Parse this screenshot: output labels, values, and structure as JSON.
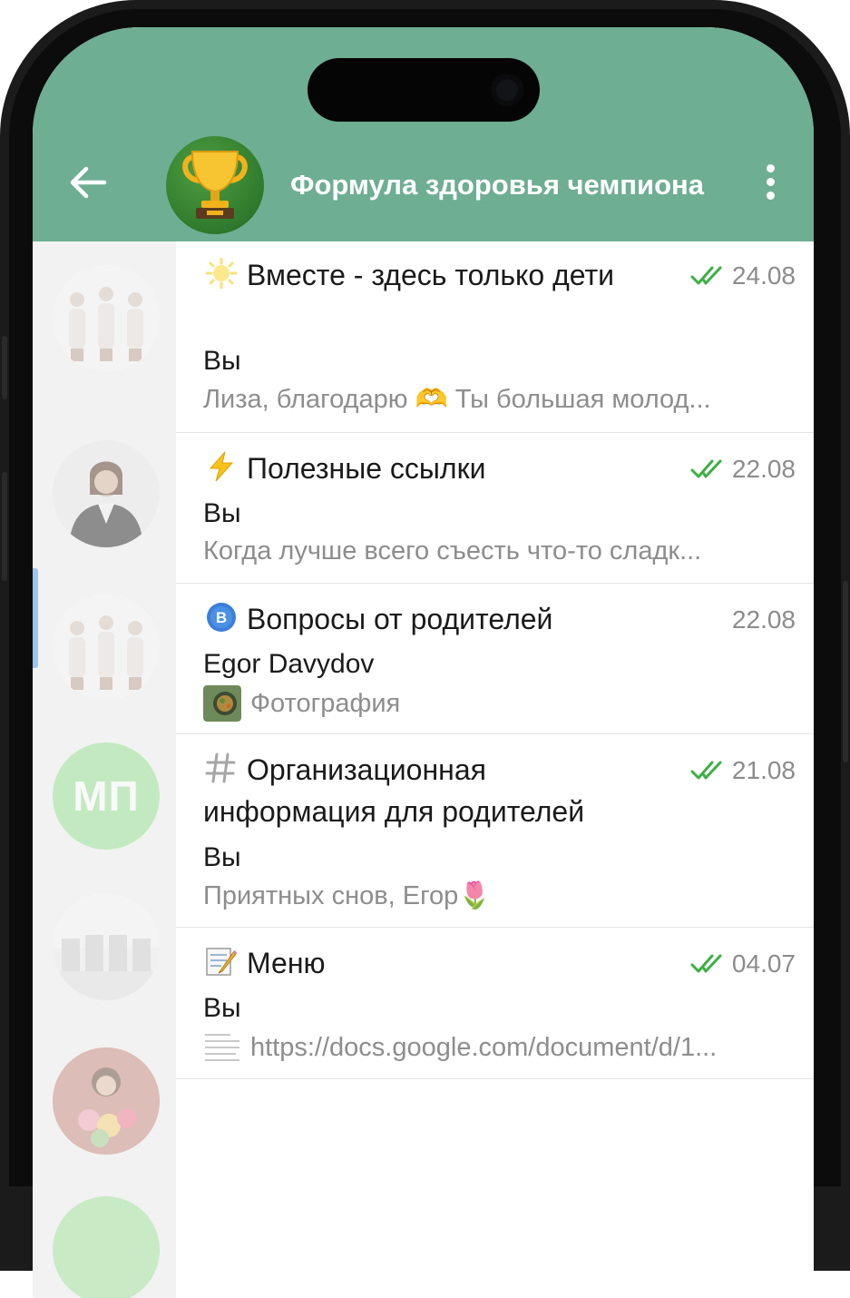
{
  "header": {
    "title": "Формула здоровья чемпиона",
    "back_icon": "arrow-left-icon",
    "avatar_icon": "trophy-icon",
    "menu_icon": "more-vertical-icon",
    "color": "#6eae93"
  },
  "topics": [
    {
      "icon": "sun-icon",
      "title": "Вместе - здесь только дети",
      "date": "24.08",
      "read": true,
      "sender": "Вы",
      "preview": "Лиза, благодарю 🫶 Ты большая молод..."
    },
    {
      "icon": "lightning-icon",
      "title": "Полезные ссылки",
      "date": "22.08",
      "read": true,
      "sender": "Вы",
      "preview": "Когда лучше всего съесть что-то сладк..."
    },
    {
      "icon": "letter-b-icon",
      "title": "Вопросы от родителей",
      "date": "22.08",
      "read": false,
      "sender": "Egor Davydov",
      "preview": "Фотография"
    },
    {
      "icon": "hash-icon",
      "title": "Организационная информация для родителей",
      "date": "21.08",
      "read": true,
      "sender": "Вы",
      "preview": "Приятных снов, Егор🌷"
    },
    {
      "icon": "memo-icon",
      "title": "Меню",
      "date": "04.07",
      "read": true,
      "sender": "Вы",
      "preview": "https://docs.google.com/document/d/1..."
    }
  ],
  "sidebar": {
    "mp_initials": "МП"
  },
  "colors": {
    "check": "#3cb043",
    "muted": "#8c8c8c"
  }
}
